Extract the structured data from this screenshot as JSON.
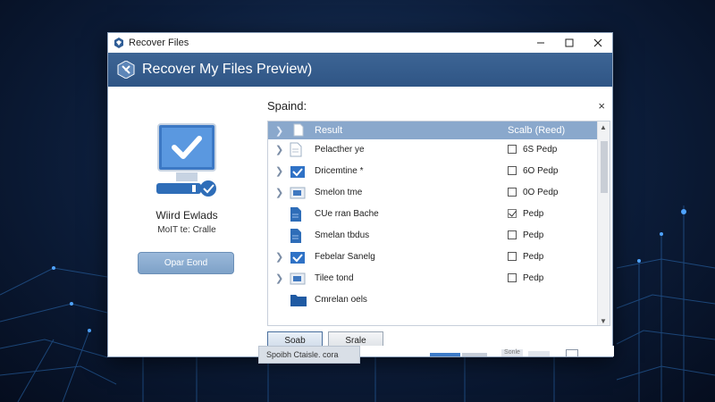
{
  "window": {
    "title": "Recover Files"
  },
  "banner": {
    "title": "Recover My Files Preview)"
  },
  "left": {
    "title": "Wiird Ewlads",
    "subtitle": "MoIT te: Cralle",
    "open_button": "Opar Eond"
  },
  "right": {
    "heading": "Spaind:",
    "close": "×",
    "header": {
      "name": "Result",
      "size": "Scalb (Reed)"
    },
    "rows": [
      {
        "name": "Pelacther ye",
        "size": "6S Pedp",
        "checked": false,
        "icon": "document-icon",
        "has_chevron": true
      },
      {
        "name": "Dricemtine *",
        "size": "6O Pedp",
        "checked": false,
        "icon": "checked-folder-icon",
        "has_chevron": true
      },
      {
        "name": "Smelon tme",
        "size": "0O Pedp",
        "checked": false,
        "icon": "image-file-icon",
        "has_chevron": true
      },
      {
        "name": "CUe rran Bache",
        "size": "Pedp",
        "checked": true,
        "icon": "blue-document-icon",
        "has_chevron": false
      },
      {
        "name": "Smelan tbdus",
        "size": "Pedp",
        "checked": false,
        "icon": "blue-document-icon",
        "has_chevron": false
      },
      {
        "name": "Febelar Sanelg",
        "size": "Pedp",
        "checked": false,
        "icon": "checked-folder-icon",
        "has_chevron": true
      },
      {
        "name": "Tilee tond",
        "size": "Pedp",
        "checked": false,
        "icon": "image-file-icon",
        "has_chevron": true
      },
      {
        "name": "Cmrelan oels",
        "size": "",
        "checked": false,
        "icon": "folder-icon",
        "has_chevron": false
      }
    ],
    "buttons": {
      "primary": "Soab",
      "secondary": "Srale"
    }
  },
  "status": {
    "tab_label": "Spoibh Ctaisle. cora",
    "item": "Sonle"
  },
  "colors": {
    "banner": "#2f5585",
    "header": "#8aa8cc",
    "accent": "#3e7cc9"
  }
}
